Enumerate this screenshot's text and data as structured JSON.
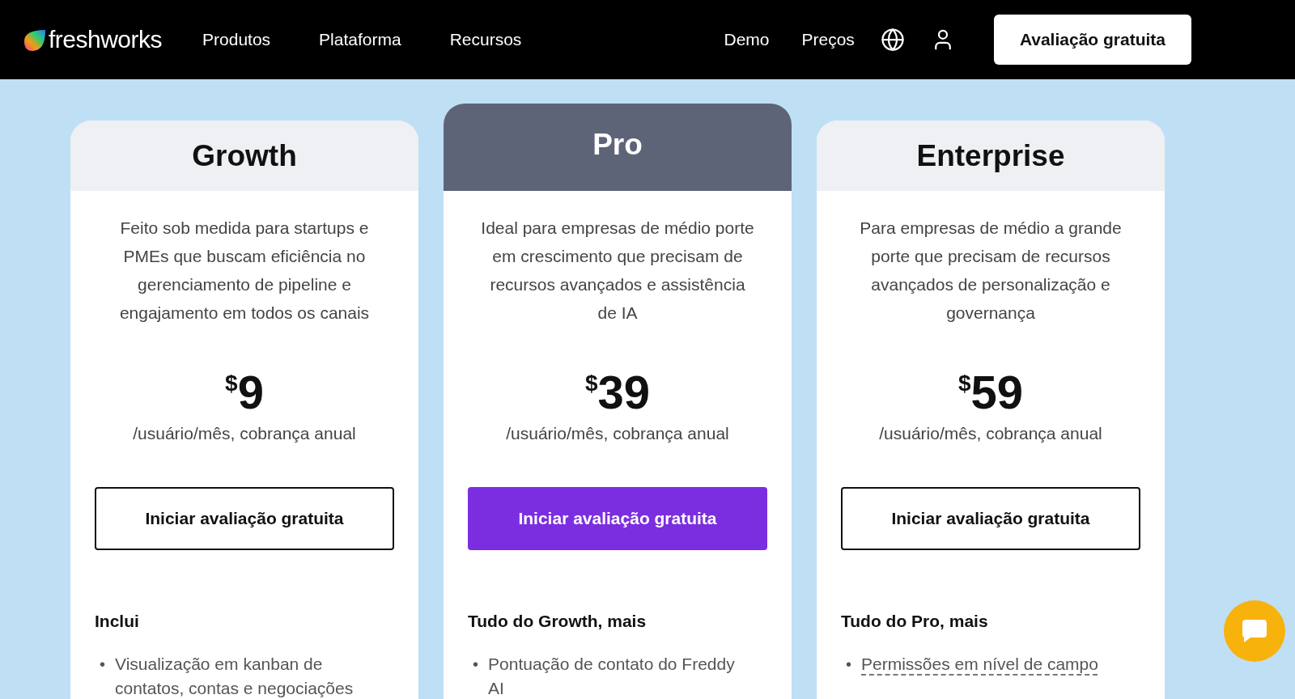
{
  "nav": {
    "brand": "freshworks",
    "links": [
      {
        "label": "Produtos"
      },
      {
        "label": "Plataforma"
      },
      {
        "label": "Recursos"
      }
    ],
    "right_links": [
      {
        "label": "Demo"
      },
      {
        "label": "Preços"
      }
    ],
    "cta": "Avaliação gratuita"
  },
  "plans": [
    {
      "name": "Growth",
      "highlighted": false,
      "description": "Feito sob medida para startups e PMEs que buscam eficiência no gerenciamento de pipeline e engajamento em todos os canais",
      "currency": "$",
      "amount": "9",
      "period": "/usuário/mês, cobrança anual",
      "button": {
        "label": "Iniciar avaliação gratuita",
        "kind": "outline"
      },
      "features_heading": "Inclui",
      "features": [
        {
          "bullet": "•",
          "text": "Visualização em kanban de contatos, contas e negociações",
          "has_tooltip": false
        }
      ]
    },
    {
      "name": "Pro",
      "highlighted": true,
      "description": "Ideal para empresas de médio porte em crescimento que precisam de recursos avançados e assistência de IA",
      "currency": "$",
      "amount": "39",
      "period": "/usuário/mês, cobrança anual",
      "button": {
        "label": "Iniciar avaliação gratuita",
        "kind": "primary"
      },
      "features_heading": "Tudo do Growth, mais",
      "features": [
        {
          "bullet": "•",
          "text": "Pontuação de contato do Freddy AI",
          "has_tooltip": false
        }
      ]
    },
    {
      "name": "Enterprise",
      "highlighted": false,
      "description": "Para empresas de médio a grande porte que precisam de recursos avançados de personalização e governança",
      "currency": "$",
      "amount": "59",
      "period": "/usuário/mês, cobrança anual",
      "button": {
        "label": "Iniciar avaliação gratuita",
        "kind": "outline"
      },
      "features_heading": "Tudo do Pro, mais",
      "features": [
        {
          "bullet": "•",
          "text": "Permissões em nível de campo",
          "has_tooltip": true
        }
      ]
    }
  ]
}
